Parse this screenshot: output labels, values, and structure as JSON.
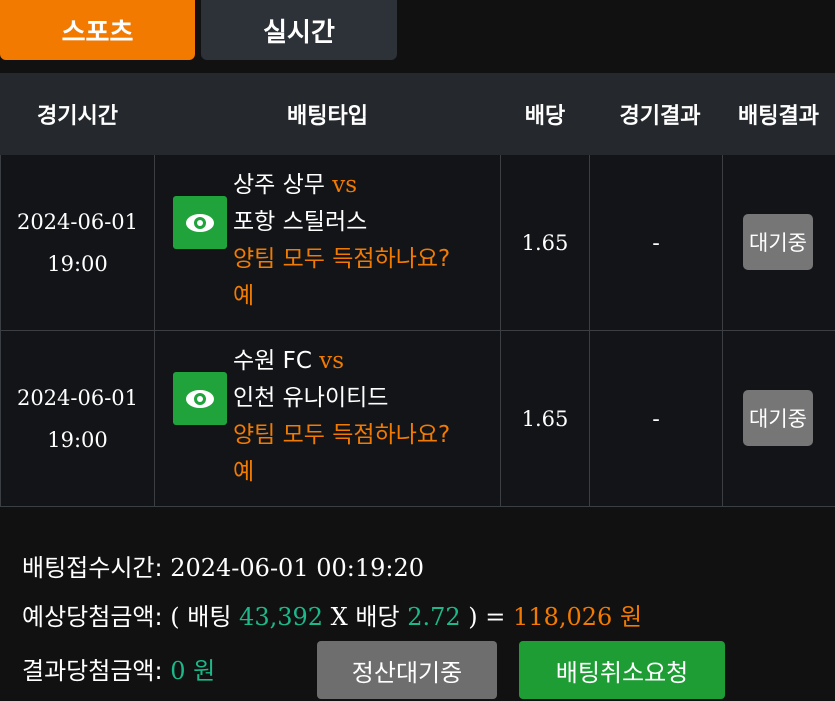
{
  "tabs": [
    {
      "label": "스포츠",
      "active": true
    },
    {
      "label": "실시간",
      "active": false
    }
  ],
  "table": {
    "headers": [
      "경기시간",
      "배팅타입",
      "배당",
      "경기결과",
      "배팅결과"
    ],
    "rows": [
      {
        "date": "2024-06-01",
        "time": "19:00",
        "home": "상주 상무",
        "vs": "vs",
        "away": "포항 스틸러스",
        "market": "양팀 모두 득점하나요?",
        "pick": "예",
        "odds": "1.65",
        "result": "-",
        "status": "대기중"
      },
      {
        "date": "2024-06-01",
        "time": "19:00",
        "home": "수원 FC",
        "vs": "vs",
        "away": "인천 유나이티드",
        "market": "양팀 모두 득점하나요?",
        "pick": "예",
        "odds": "1.65",
        "result": "-",
        "status": "대기중"
      }
    ]
  },
  "summary": {
    "accept_time_label": "배팅접수시간:",
    "accept_time_value": "2024-06-01 00:19:20",
    "expected_label": "예상당첨금액:",
    "open_paren": "(",
    "bet_label": "배팅",
    "bet_amount": "43,392",
    "times": "X",
    "odds_label": "배당",
    "total_odds": "2.72",
    "close_eq": ") =",
    "expected_amount": "118,026",
    "expected_unit": "원",
    "result_label": "결과당첨금액:",
    "result_amount": "0",
    "result_unit": "원"
  },
  "buttons": {
    "settle_wait": "정산대기중",
    "cancel_request": "배팅취소요청"
  },
  "colors": {
    "accent_orange": "#f27a00",
    "green": "#1db889",
    "eye_green": "#1fa33a",
    "cancel_green": "#1e9d35"
  }
}
